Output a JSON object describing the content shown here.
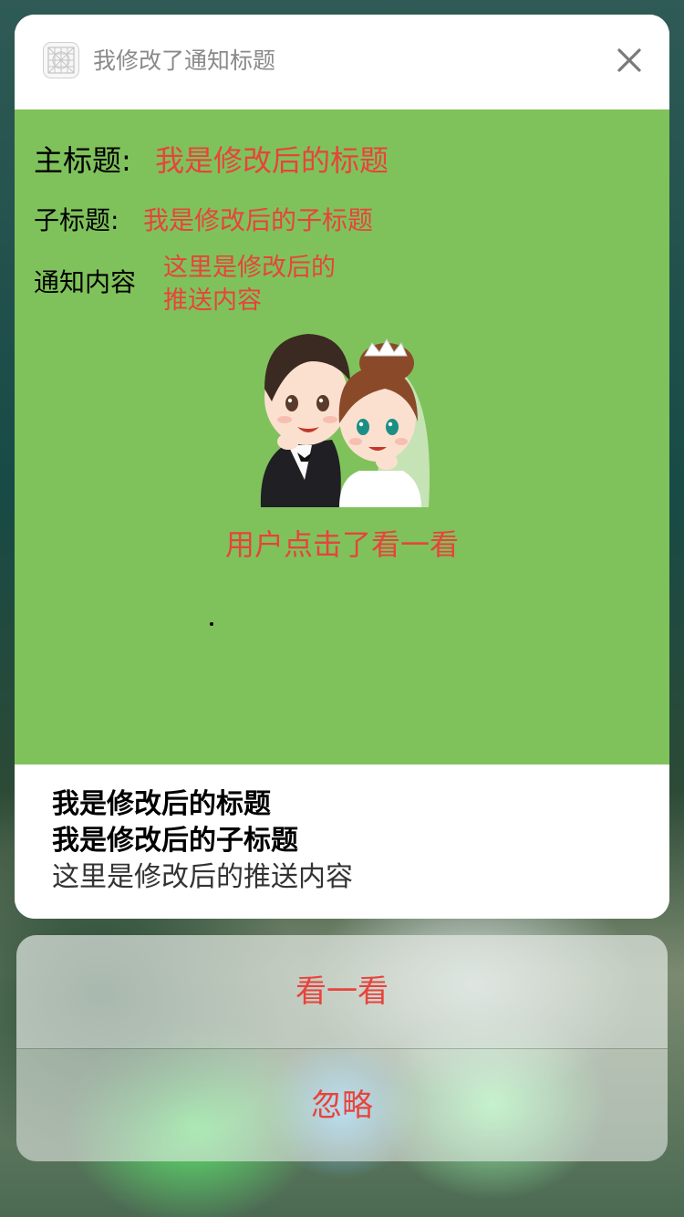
{
  "notification": {
    "header_title": "我修改了通知标题",
    "app_icon": "grid-app-icon",
    "close_icon": "close-icon"
  },
  "content": {
    "main_title_label": "主标题:",
    "main_title_value": "我是修改后的标题",
    "subtitle_label": "子标题:",
    "subtitle_value": "我是修改后的子标题",
    "body_label": "通知内容",
    "body_value": "这里是修改后的推送内容",
    "image": "cartoon-couple-image",
    "action_feedback": "用户点击了看一看",
    "background_color": "#7fc25b",
    "accent_color": "#e8433c"
  },
  "summary": {
    "title": "我是修改后的标题",
    "subtitle": "我是修改后的子标题",
    "body": "这里是修改后的推送内容"
  },
  "actions": [
    {
      "label": "看一看"
    },
    {
      "label": "忽略"
    }
  ]
}
